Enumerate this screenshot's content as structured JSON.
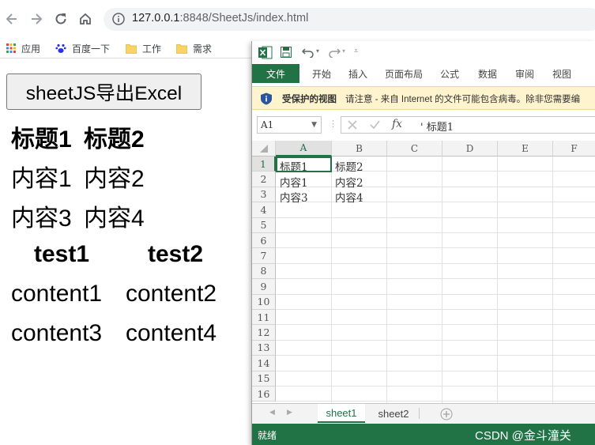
{
  "browser": {
    "url_host": "127.0.0.1",
    "url_path": ":8848/SheetJs/index.html",
    "bookmarks": [
      "应用",
      "百度一下",
      "工作",
      "需求"
    ]
  },
  "page": {
    "export_button": "sheetJS导出Excel",
    "table1": {
      "headers": [
        "标题1",
        "标题2"
      ],
      "rows": [
        [
          "内容1",
          "内容2"
        ],
        [
          "内容3",
          "内容4"
        ]
      ]
    },
    "table2": {
      "headers": [
        "test1",
        "test2"
      ],
      "rows": [
        [
          "content1",
          "content2"
        ],
        [
          "content3",
          "content4"
        ]
      ]
    }
  },
  "excel": {
    "tabs": [
      "文件",
      "开始",
      "插入",
      "页面布局",
      "公式",
      "数据",
      "审阅",
      "视图"
    ],
    "protected_title": "受保护的视图",
    "protected_message": "请注意 - 来自 Internet 的文件可能包含病毒。除非您需要编",
    "name_box": "A1",
    "formula_value": "' 标题1",
    "columns": [
      "A",
      "B",
      "C",
      "D",
      "E",
      "F"
    ],
    "rows": [
      "1",
      "2",
      "3",
      "4",
      "5",
      "6",
      "7",
      "8",
      "9",
      "10",
      "11",
      "12",
      "13",
      "14",
      "15",
      "16"
    ],
    "cells": [
      [
        "标题1",
        "标题2"
      ],
      [
        "内容1",
        "内容2"
      ],
      [
        "内容3",
        "内容4"
      ]
    ],
    "sheets": [
      "sheet1",
      "sheet2"
    ],
    "status": "就绪",
    "watermark": "CSDN @金斗潼关"
  },
  "colors": {
    "excel_green": "#217346",
    "protect_bar": "#fff4ce"
  }
}
